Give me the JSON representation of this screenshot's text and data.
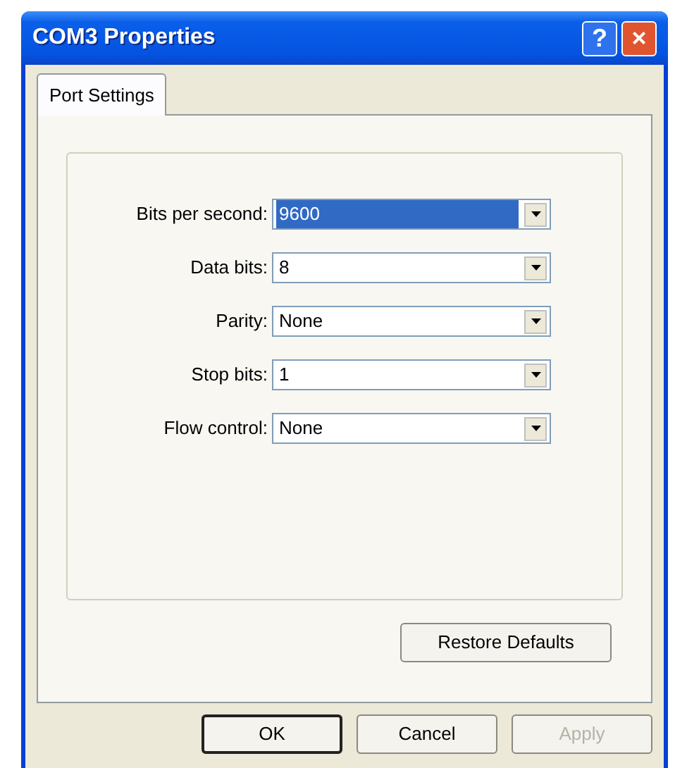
{
  "window": {
    "title": "COM3 Properties"
  },
  "title_buttons": [
    {
      "kind": "help",
      "label": "?"
    },
    {
      "kind": "close",
      "label": "×"
    }
  ],
  "tabs": [
    {
      "label": "Port Settings",
      "selected": true
    }
  ],
  "settings": [
    {
      "label": "Bits per second:",
      "value": "9600",
      "highlighted": true
    },
    {
      "label": "Data bits:",
      "value": "8",
      "highlighted": false
    },
    {
      "label": "Parity:",
      "value": "None",
      "highlighted": false
    },
    {
      "label": "Stop bits:",
      "value": "1",
      "highlighted": false
    },
    {
      "label": "Flow control:",
      "value": "None",
      "highlighted": false
    }
  ],
  "restore_button": "Restore Defaults",
  "buttons": [
    {
      "label": "OK",
      "default": true,
      "disabled": false
    },
    {
      "label": "Cancel",
      "default": false,
      "disabled": false
    },
    {
      "label": "Apply",
      "default": false,
      "disabled": true
    }
  ]
}
